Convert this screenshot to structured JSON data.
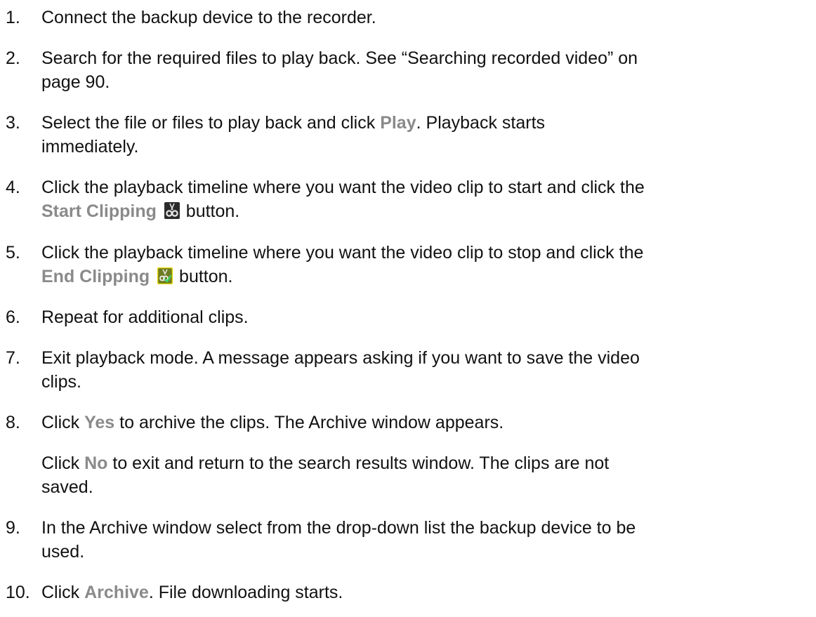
{
  "steps": [
    {
      "number": "1.",
      "text": "Connect the backup device to the recorder."
    },
    {
      "number": "2.",
      "line1": "Search for the required files to play back. See “Searching recorded video” on",
      "line2": "page 90."
    },
    {
      "number": "3.",
      "pre": "Select the file or files to play back and click ",
      "button": "Play",
      "post": ". Playback starts",
      "line2": "immediately."
    },
    {
      "number": "4.",
      "line1": "Click the playback timeline where you want the video clip to start and click the",
      "button": "Start Clipping",
      "icon": "scissors-icon",
      "post": "button."
    },
    {
      "number": "5.",
      "line1": "Click the playback timeline where you want the video clip to stop and click the",
      "button": "End Clipping",
      "icon": "scissors-check-icon",
      "post": "button."
    },
    {
      "number": "6.",
      "text": "Repeat for additional clips."
    },
    {
      "number": "7.",
      "line1": "Exit playback mode. A message appears asking if you want to save the video",
      "line2": "clips."
    },
    {
      "number": "8.",
      "pre": "Click ",
      "button": "Yes",
      "post": " to archive the clips. The Archive window appears."
    },
    {
      "note_pre": "Click ",
      "note_button": "No",
      "note_post": " to exit and return to the search results window. The clips are not",
      "note_line2": "saved."
    },
    {
      "number": "9.",
      "line1": "In the Archive window select from the drop-down list the backup device to be",
      "line2": "used."
    },
    {
      "number": "10.",
      "pre": "Click ",
      "button": "Archive",
      "post": ". File downloading starts."
    }
  ],
  "colors": {
    "text": "#111111",
    "ui_label": "#8a8a8a",
    "icon_bg_dark": "#2b2b2b",
    "icon_bg_green": "#8a9a2a",
    "icon_border_yellow": "#e8d800"
  }
}
